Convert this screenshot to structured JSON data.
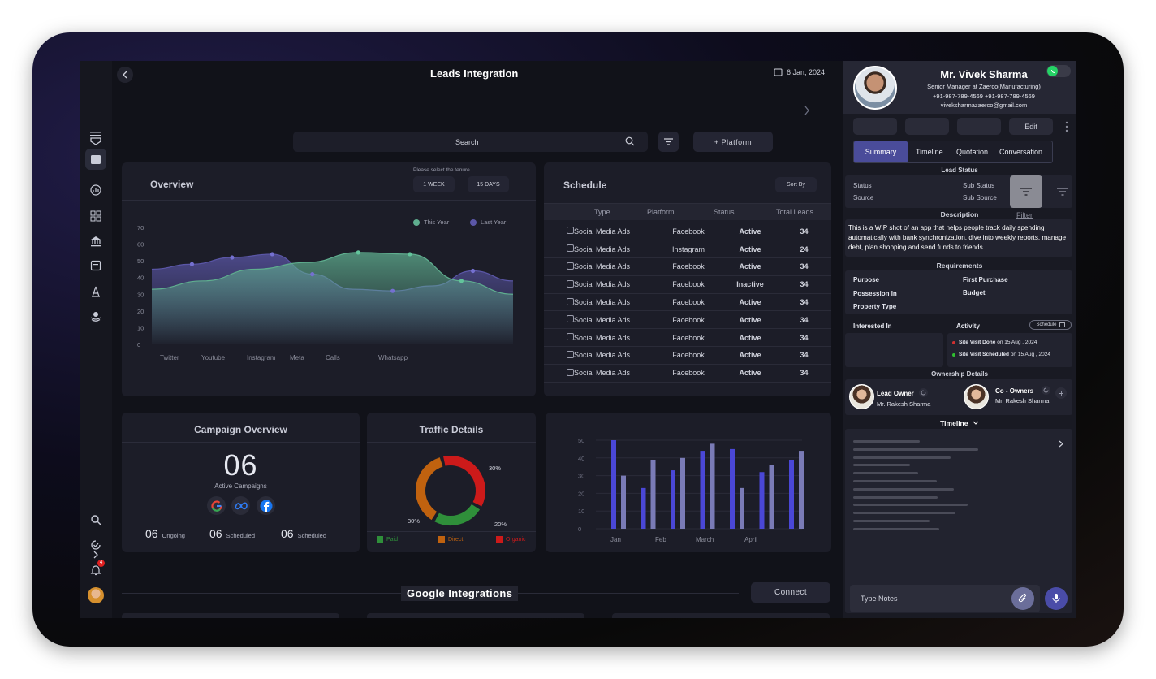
{
  "header": {
    "title": "Leads Integration",
    "date": "6 Jan, 2024"
  },
  "search": {
    "placeholder": "Search",
    "platform_button": "+ Platform"
  },
  "overview": {
    "title": "Overview",
    "tenure_label": "Please select the tenure",
    "tenure_options": [
      "1 WEEK",
      "15 DAYS"
    ],
    "legend": [
      "This Year",
      "Last Year"
    ],
    "y_ticks": [
      "70",
      "60",
      "50",
      "40",
      "30",
      "20",
      "10",
      "0"
    ],
    "x_labels": [
      "Twitter",
      "Youtube",
      "Instagram",
      "Meta",
      "Calls",
      "Whatsapp"
    ]
  },
  "schedule": {
    "title": "Schedule",
    "sort_label": "Sort By",
    "columns": [
      "Type",
      "Platform",
      "Status",
      "Total Leads"
    ],
    "rows": [
      {
        "type": "Social Media Ads",
        "platform": "Facebook",
        "status": "Active",
        "leads": "34"
      },
      {
        "type": "Social Media Ads",
        "platform": "Instagram",
        "status": "Active",
        "leads": "24"
      },
      {
        "type": "Social Media Ads",
        "platform": "Facebook",
        "status": "Active",
        "leads": "34"
      },
      {
        "type": "Social Media Ads",
        "platform": "Facebook",
        "status": "Inactive",
        "leads": "34"
      },
      {
        "type": "Social Media Ads",
        "platform": "Facebook",
        "status": "Active",
        "leads": "34"
      },
      {
        "type": "Social Media Ads",
        "platform": "Facebook",
        "status": "Active",
        "leads": "34"
      },
      {
        "type": "Social Media Ads",
        "platform": "Facebook",
        "status": "Active",
        "leads": "34"
      },
      {
        "type": "Social Media Ads",
        "platform": "Facebook",
        "status": "Active",
        "leads": "34"
      },
      {
        "type": "Social Media Ads",
        "platform": "Facebook",
        "status": "Active",
        "leads": "34"
      }
    ]
  },
  "campaign": {
    "title": "Campaign Overview",
    "count": "06",
    "count_label": "Active Campaigns",
    "stats": [
      {
        "value": "06",
        "label": "Ongoing"
      },
      {
        "value": "06",
        "label": "Scheduled"
      },
      {
        "value": "06",
        "label": "Scheduled"
      }
    ]
  },
  "traffic": {
    "title": "Traffic Details",
    "legend": [
      "Paid",
      "Direct",
      "Organic"
    ],
    "colors": {
      "paid": "#2f8f3a",
      "direct": "#c0620f",
      "organic": "#cc1a1a"
    }
  },
  "google": {
    "title": "Google Integrations",
    "connect": "Connect"
  },
  "chart_data": [
    {
      "type": "area",
      "title": "Overview",
      "categories": [
        "Twitter",
        "Youtube",
        "Instagram",
        "Meta",
        "Calls",
        "Whatsapp"
      ],
      "series": [
        {
          "name": "This Year",
          "color": "#5fae8f",
          "values": [
            33,
            38,
            45,
            49,
            55,
            54,
            38,
            30
          ]
        },
        {
          "name": "Last Year",
          "color": "#5b57a8",
          "values": [
            45,
            48,
            52,
            54,
            42,
            33,
            32,
            35,
            44,
            38
          ]
        }
      ],
      "ylim": [
        0,
        70
      ]
    },
    {
      "type": "pie",
      "title": "Traffic Details",
      "labels": [
        "Organic",
        "Paid",
        "Direct"
      ],
      "values": [
        30,
        20,
        30
      ]
    },
    {
      "type": "bar",
      "categories": [
        "Jan",
        "Feb",
        "March",
        "April"
      ],
      "y_ticks": [
        "50",
        "40",
        "30",
        "20",
        "10",
        "0"
      ],
      "ylim": [
        0,
        50
      ],
      "series": [
        {
          "color": "#4a47d6",
          "values": [
            50,
            23,
            33,
            44,
            45,
            32,
            39
          ]
        },
        {
          "color": "#7a7bb6",
          "values": [
            30,
            39,
            40,
            48,
            23,
            36,
            44
          ]
        }
      ]
    }
  ],
  "profile": {
    "name": "Mr. Vivek Sharma",
    "role": "Senior Manager at Zaerco(Manufacturing)",
    "phones": "+91-987-789-4569  +91-987-789-4569",
    "email": "viveksharmazaerco@gmail.com",
    "edit": "Edit",
    "tabs": [
      "Summary",
      "Timeline",
      "Quotation",
      "Conversation"
    ],
    "lead_status_label": "Lead Status",
    "status_fields": [
      "Status",
      "Source",
      "Sub Status",
      "Sub Source"
    ],
    "filter": "Filter",
    "description_title": "Description",
    "description": "This is a WIP shot of an app that helps people track daily spending automatically with bank synchronization, dive into weekly reports, manage debt, plan shopping and send funds to friends.",
    "requirements_title": "Requirements",
    "requirements": [
      "Purpose",
      "First Purchase",
      "Possession In",
      "Budget",
      "Property Type"
    ],
    "interested_in": "Interested In",
    "activity_title": "Activity",
    "schedule_btn": "Schedule",
    "activities": [
      {
        "title": "Site Visit Done",
        "suffix": " on 15 Aug , 2024",
        "color": "#d03030"
      },
      {
        "title": "Site Visit Scheduled",
        "suffix": " on 15 Aug , 2024",
        "color": "#30c030"
      }
    ],
    "ownership_title": "Ownership Details",
    "lead_owner": "Lead Owner",
    "lead_owner_name": "Mr. Rakesh Sharma",
    "co_owner": "Co - Owners",
    "co_owner_name": "Mr. Rakesh Sharma",
    "timeline_title": "Timeline",
    "notes_placeholder": "Type Notes"
  },
  "notifications": {
    "badge": "4"
  }
}
